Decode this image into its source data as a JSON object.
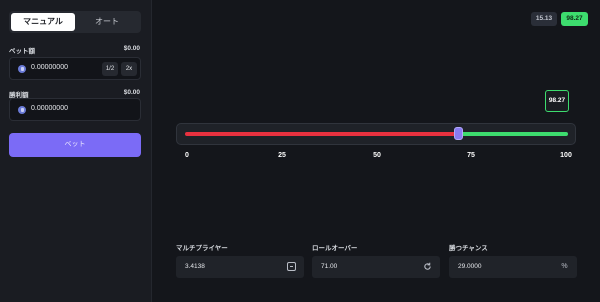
{
  "mode_toggle": {
    "manual": "マニュアル",
    "auto": "オート"
  },
  "bet": {
    "label": "ベット額",
    "usd_amount": "$0.00",
    "value": "0.00000000",
    "half_label": "1/2",
    "double_label": "2x"
  },
  "profit": {
    "label": "勝利額",
    "usd_amount": "$0.00",
    "value": "0.00000000"
  },
  "bet_button_label": "ベット",
  "recent_results": [
    {
      "value": "15.13",
      "color": "#2a2e38"
    },
    {
      "value": "98.27",
      "color": "#3ddc6e"
    }
  ],
  "slider": {
    "result_marker": "98.27",
    "roll_over_value": 71,
    "ticks": [
      "0",
      "25",
      "50",
      "75",
      "100"
    ],
    "lose_color": "#e8313f",
    "win_color": "#3ddc6e",
    "thumb_color": "#8a7bf0"
  },
  "stats": {
    "multiplier": {
      "label": "マルチプライヤー",
      "value": "3.4138",
      "icon": "multiplier-icon"
    },
    "roll_over": {
      "label": "ロールオーバー",
      "value": "71.00",
      "icon": "refresh-icon"
    },
    "win_chance": {
      "label": "勝つチャンス",
      "value": "29.0000",
      "icon": "percent-icon"
    }
  },
  "accent_color": "#7b6bf6"
}
